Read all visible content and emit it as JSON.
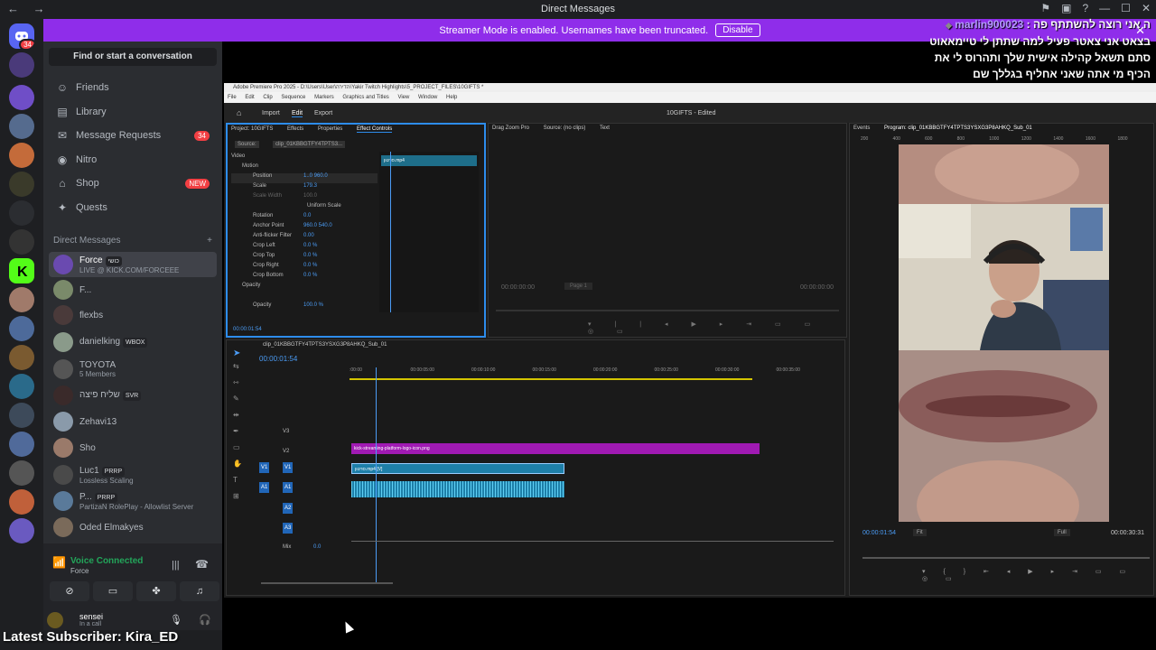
{
  "window": {
    "title": "Direct Messages",
    "nav": "← →"
  },
  "banner": {
    "text": "Streamer Mode is enabled. Usernames have been truncated.",
    "button": "Disable"
  },
  "server_badge": "34",
  "sidebar": {
    "find": "Find or start a conversation",
    "nav": [
      {
        "label": "Friends",
        "icon": "friends-icon"
      },
      {
        "label": "Library",
        "icon": "library-icon"
      },
      {
        "label": "Message Requests",
        "icon": "mail-icon",
        "badge": "34"
      },
      {
        "label": "Nitro",
        "icon": "nitro-icon"
      },
      {
        "label": "Shop",
        "icon": "shop-icon",
        "badge": "NEW"
      },
      {
        "label": "Quests",
        "icon": "quests-icon"
      }
    ],
    "dm_header": "Direct Messages",
    "dms": [
      {
        "name": "Force",
        "tag": "כושי",
        "sub": "LIVE @ KICK.COM/FORCEEE"
      },
      {
        "name": "F...",
        "tag": "",
        "sub": ""
      },
      {
        "name": "flexbs",
        "tag": "",
        "sub": ""
      },
      {
        "name": "danielking",
        "tag": "WBOX",
        "sub": ""
      },
      {
        "name": "TOYOTA",
        "tag": "",
        "sub": "5 Members"
      },
      {
        "name": "שליח פיצה",
        "tag": "SVR",
        "sub": ""
      },
      {
        "name": "Zehavi13",
        "tag": "",
        "sub": ""
      },
      {
        "name": "Sho",
        "tag": "",
        "sub": ""
      },
      {
        "name": "Luc1",
        "tag": "PRRP",
        "sub": "Lossless Scaling"
      },
      {
        "name": "P...",
        "tag": "PRRP",
        "sub": "PartizaN RolePlay - Allowlist Server"
      },
      {
        "name": "Oded Elmakyes",
        "tag": "",
        "sub": ""
      }
    ]
  },
  "voice": {
    "status": "Voice Connected",
    "channel": "Force"
  },
  "user": {
    "name": "sensei",
    "status": "In a call"
  },
  "overlay": {
    "subscriber": "Latest Subscriber: Kira_ED",
    "chat_user": "marlin900023",
    "chat_lines": [
      "ה אני רוצה להשתתף פה :",
      "בצאט אני צאטר פעיל למה שתתן לי טיימאאוט",
      "סתם תשאל קהילה אישית שלך ותהרוס לי את",
      "הכיף מי אתה שאני אחליף בגללך שם"
    ]
  },
  "premiere": {
    "titlebar": "Adobe Premiere Pro 2025 - D:\\Users\\User\\הדירה\\Yakir Twitch Highlights\\5_PROJECT_FILES\\10GIFTS *",
    "menu": [
      "File",
      "Edit",
      "Clip",
      "Sequence",
      "Markers",
      "Graphics and Titles",
      "View",
      "Window",
      "Help"
    ],
    "workspace": [
      "Import",
      "Edit",
      "Export"
    ],
    "project_name": "10GIFTS - Edited",
    "left_tabs": [
      "Project: 10GIFTS",
      "Effects",
      "Properties",
      "Effect Controls"
    ],
    "source_tabs": [
      "Drag Zoom Pro",
      "Source: (no clips)",
      "Text"
    ],
    "program_tabs": [
      "Events",
      "Program: clip_01KBBGTFY4TPTS3YSXG3P8AHKQ_Sub_01"
    ],
    "source_clip": "Source: ",
    "fx_clip": "clip_01KBBGTFY4TPTS3...",
    "fx_props": [
      {
        "name": "Video",
        "value": ""
      },
      {
        "name": "Motion",
        "value": ""
      },
      {
        "name": "Position",
        "value": "1..0  960.0"
      },
      {
        "name": "Scale",
        "value": "179.3"
      },
      {
        "name": "Scale Width",
        "value": "100.0"
      },
      {
        "name": "Uniform Scale",
        "value": ""
      },
      {
        "name": "Rotation",
        "value": "0.0"
      },
      {
        "name": "Anchor Point",
        "value": "960.0   540.0"
      },
      {
        "name": "Anti-flicker Filter",
        "value": "0.00"
      },
      {
        "name": "Crop Left",
        "value": "0.0 %"
      },
      {
        "name": "Crop Top",
        "value": "0.0 %"
      },
      {
        "name": "Crop Right",
        "value": "0.0 %"
      },
      {
        "name": "Crop Bottom",
        "value": "0.0 %"
      },
      {
        "name": "Opacity",
        "value": ""
      },
      {
        "name": "Opacity",
        "value": "100.0 %"
      }
    ],
    "fx_time": "00:00:01:54",
    "mini_clip": "סרטון.mp4",
    "source_timecode_left": "00:00:00:00",
    "source_timecode_right": "00:00:00:00",
    "page": "Page 1",
    "sequence_tab": "clip_01KBBGTFY4TPTS3YSXG3P8AHKQ_Sub_01",
    "seq_time": "00:00:01:54",
    "ruler": [
      ":00:00",
      "00:00:05:00",
      "00:00:10:00",
      "00:00:15:00",
      "00:00:20:00",
      "00:00:25:00",
      "00:00:30:00",
      "00:00:35:00"
    ],
    "tracks": [
      "V3",
      "V2",
      "V1",
      "A1",
      "A2",
      "A3",
      "Mix"
    ],
    "mix_value": "0.0",
    "clip_png": "kick-streaming-platform-logo-icon.png",
    "clip_mp4": "סרטון.mp4 [V]",
    "program_time": "00:00:01:54",
    "program_fit": "Fit",
    "program_quality": "Full",
    "program_duration": "00:00:30:31",
    "program_ruler": [
      "200",
      "400",
      "600",
      "800",
      "1000",
      "1200",
      "1400",
      "1600",
      "1800"
    ]
  }
}
